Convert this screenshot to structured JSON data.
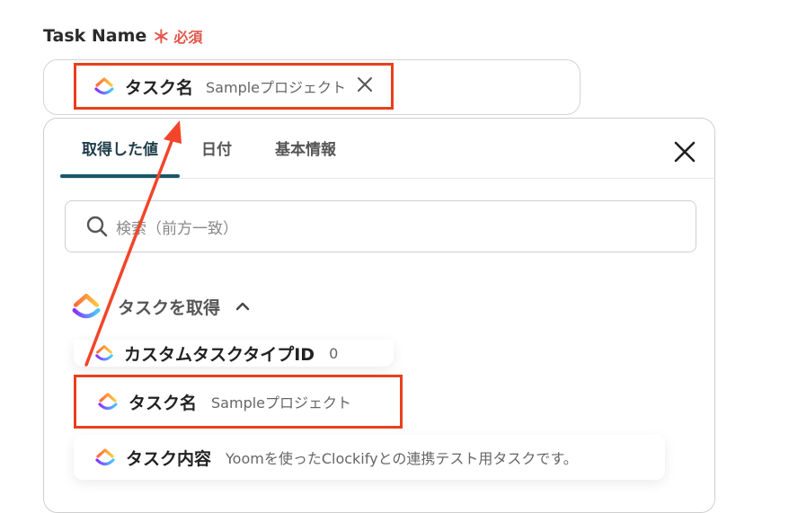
{
  "field": {
    "label": "Task Name",
    "required_mark": "＊",
    "required_text": "必須"
  },
  "selected_chip": {
    "label": "タスク名",
    "value": "Sampleプロジェクト",
    "icon": "clickup-logo-icon"
  },
  "tabs": [
    {
      "label": "取得した値",
      "active": true
    },
    {
      "label": "日付",
      "active": false
    },
    {
      "label": "基本情報",
      "active": false
    }
  ],
  "search": {
    "placeholder": "検索（前方一致）"
  },
  "group": {
    "title": "タスクを取得",
    "expanded": true
  },
  "items": [
    {
      "label": "カスタムタスクタイプID",
      "value": "0"
    },
    {
      "label": "タスク名",
      "value": "Sampleプロジェクト"
    },
    {
      "label": "タスク内容",
      "value": "Yoomを使ったClockifyとの連携テスト用タスクです。"
    }
  ],
  "colors": {
    "highlight": "#e8401c",
    "active_tab": "#17576a",
    "required": "#e2574c"
  }
}
